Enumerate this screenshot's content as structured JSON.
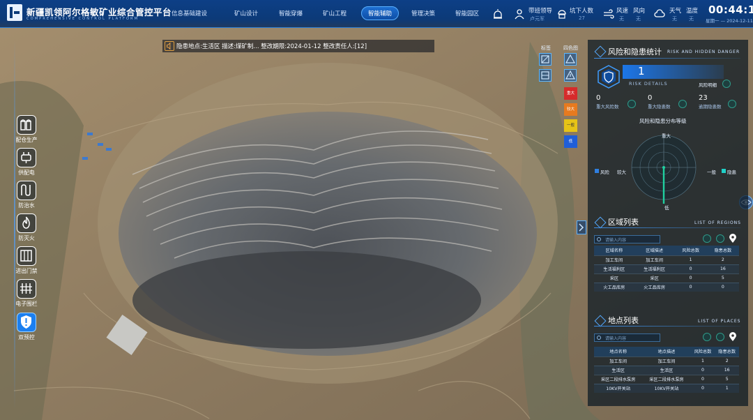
{
  "header": {
    "title": "新疆凯领阿尔格敏矿业综合管控平台",
    "subtitle": "COMPREHENSIVE CONTROL PLATFORM",
    "nav": [
      {
        "label": "信息基础建设",
        "active": false
      },
      {
        "label": "矿山设计",
        "active": false
      },
      {
        "label": "智能穿爆",
        "active": false
      },
      {
        "label": "矿山工程",
        "active": false
      },
      {
        "label": "智能辅助",
        "active": true
      },
      {
        "label": "管理决策",
        "active": false
      },
      {
        "label": "智能园区",
        "active": false
      }
    ],
    "duty": {
      "label": "带班领导",
      "value": "卢元军"
    },
    "underground": {
      "label": "坑下人数",
      "value": "27"
    },
    "wind_speed": {
      "label": "风速",
      "value": "无"
    },
    "wind_dir": {
      "label": "风向",
      "value": "无"
    },
    "weather": {
      "label": "天气",
      "value": "无"
    },
    "temperature": {
      "label": "温度",
      "value": "无"
    },
    "time": "00:44:14",
    "date": "星期一 — 2024-12-11"
  },
  "alert": {
    "text": "隐患地点:生活区 描述:煤矿制... 整改期限:2024-01-12 整改责任人:[12]"
  },
  "left_dock": [
    {
      "label": "配仓生产",
      "icon": "silo-icon",
      "active": false
    },
    {
      "label": "供配电",
      "icon": "power-plug-icon",
      "active": false
    },
    {
      "label": "防治水",
      "icon": "water-pipe-icon",
      "active": false
    },
    {
      "label": "防灭火",
      "icon": "fire-icon",
      "active": false
    },
    {
      "label": "进出门禁",
      "icon": "gate-icon",
      "active": false
    },
    {
      "label": "电子围栏",
      "icon": "fence-icon",
      "active": false
    },
    {
      "label": "双预控",
      "icon": "shield-alert-icon",
      "active": true
    }
  ],
  "tool_columns": {
    "left_head": "标签",
    "right_head": "四色图",
    "levels": [
      {
        "label": "重大",
        "color": "#d62b2b"
      },
      {
        "label": "较大",
        "color": "#e77a1f"
      },
      {
        "label": "一般",
        "color": "#e6c317"
      },
      {
        "label": "低",
        "color": "#1f5ed8"
      }
    ]
  },
  "risk": {
    "title": "风险和隐患统计",
    "title_en": "RISK AND HIDDEN DANGER",
    "big_value": "1",
    "risk_details": "RISK DETAILS",
    "risk_detail_label": "风险明细",
    "stats": [
      {
        "value": "0",
        "label": "重大风险数"
      },
      {
        "value": "0",
        "label": "重大隐患数"
      },
      {
        "value": "23",
        "label": "逾期隐患数"
      }
    ],
    "dist_title": "风险和隐患分布等级",
    "radar_labels": {
      "top": "重大",
      "left": "较大",
      "right": "一般",
      "bottom": "低"
    },
    "legend_risk": "风险",
    "legend_hazard": "隐患",
    "colors": {
      "risk": "#2f7fe0",
      "hazard": "#20d0c8"
    }
  },
  "regions": {
    "title": "区域列表",
    "title_en": "LIST OF REGIONS",
    "search_placeholder": "请输入内容",
    "headers": [
      "区域名称",
      "区域描述",
      "风险总数",
      "隐患总数"
    ],
    "rows": [
      [
        "加工车间",
        "加工车间",
        "1",
        "2"
      ],
      [
        "生活福利区",
        "生活福利区",
        "0",
        "16"
      ],
      [
        "采区",
        "采区",
        "0",
        "5"
      ],
      [
        "火工品库房",
        "火工品库房",
        "0",
        "0"
      ]
    ]
  },
  "places": {
    "title": "地点列表",
    "title_en": "LIST OF PLACES",
    "search_placeholder": "请输入内容",
    "headers": [
      "地点名称",
      "地点描述",
      "风险总数",
      "隐患总数"
    ],
    "rows": [
      [
        "加工车间",
        "加工车间",
        "1",
        "2"
      ],
      [
        "生活区",
        "生活区",
        "0",
        "16"
      ],
      [
        "采区二段排水泵房",
        "采区二段排水泵房",
        "0",
        "5"
      ],
      [
        "10KV开关站",
        "10KV开关站",
        "0",
        "1"
      ]
    ]
  }
}
